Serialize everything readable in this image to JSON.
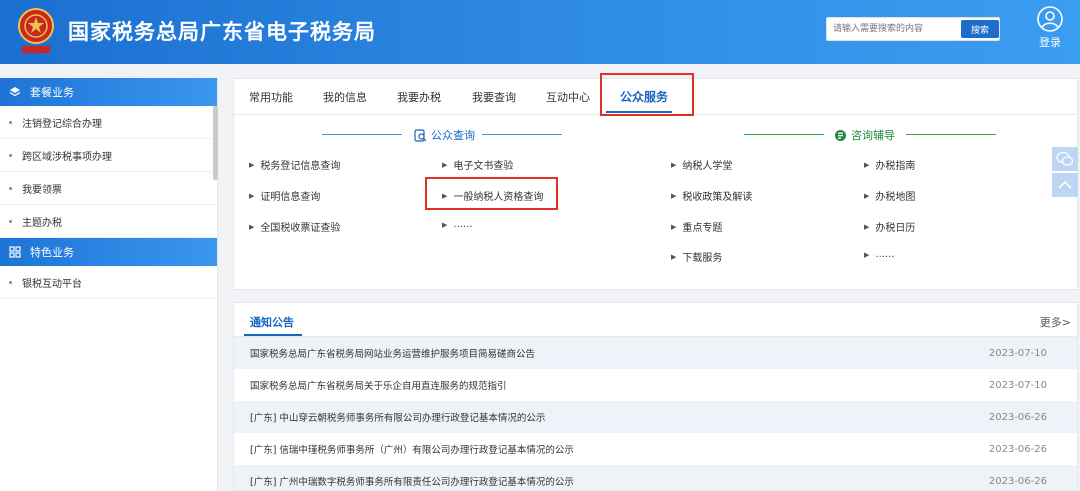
{
  "header": {
    "title": "国家税务总局广东省电子税务局",
    "search_placeholder": "请输入需要搜索的内容",
    "search_button": "搜索",
    "login_label": "登录",
    "icons": [
      "emblem-icon",
      "user-icon"
    ]
  },
  "sidebar": {
    "groups": [
      {
        "title": "套餐业务",
        "icon": "layers-icon",
        "items": [
          "注销登记综合办理",
          "跨区域涉税事项办理",
          "我要领票",
          "主题办税"
        ]
      },
      {
        "title": "特色业务",
        "icon": "grid-icon",
        "items": [
          "银税互动平台"
        ]
      }
    ]
  },
  "tabs": {
    "items": [
      "常用功能",
      "我的信息",
      "我要办税",
      "我要查询",
      "互动中心",
      "公众服务"
    ],
    "active": "公众服务"
  },
  "public_query": {
    "title": "公众查询",
    "links": [
      "税务登记信息查询",
      "电子文书查验",
      "证明信息查询",
      "一般纳税人资格查询",
      "全国税收票证查验",
      "......"
    ]
  },
  "consulting": {
    "title": "咨询辅导",
    "links": [
      "纳税人学堂",
      "办税指南",
      "税收政策及解读",
      "办税地图",
      "重点专题",
      "办税日历",
      "下载服务",
      "......"
    ]
  },
  "notices": {
    "title": "通知公告",
    "more": "更多>",
    "rows": [
      {
        "text": "国家税务总局广东省税务局网站业务运营维护服务项目简易磋商公告",
        "date": "2023-07-10"
      },
      {
        "text": "国家税务总局广东省税务局关于乐企自用直连服务的规范指引",
        "date": "2023-07-10"
      },
      {
        "text": "[广东] 中山穿云朝税务师事务所有限公司办理行政登记基本情况的公示",
        "date": "2023-06-26"
      },
      {
        "text": "[广东] 信瑞中瑾税务师事务所（广州）有限公司办理行政登记基本情况的公示",
        "date": "2023-06-26"
      },
      {
        "text": "[广东] 广州中瑞数字税务师事务所有限责任公司办理行政登记基本情况的公示",
        "date": "2023-06-26"
      }
    ]
  },
  "colors": {
    "primary": "#1766c4",
    "header": "#2f8ce6",
    "highlight": "#e0302a",
    "green": "#1f8a3b"
  }
}
